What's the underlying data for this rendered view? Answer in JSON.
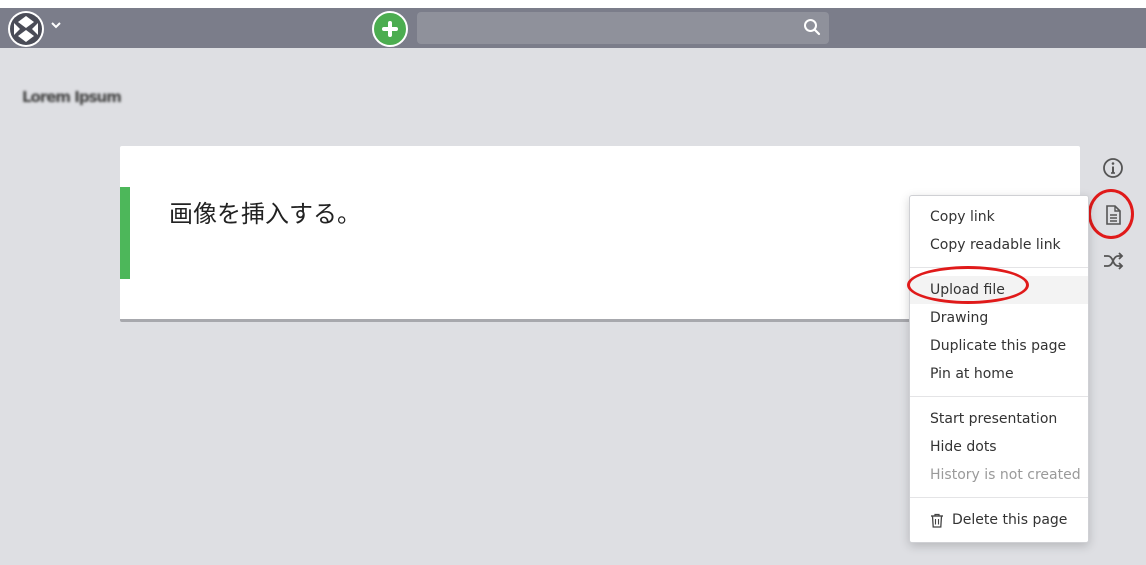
{
  "navbar": {
    "logo_icon": "project-logo-icon",
    "caret_icon": "chevron-down-icon",
    "add_icon": "plus-icon",
    "search": {
      "value": "",
      "placeholder": ""
    },
    "search_icon": "search-icon",
    "bg_color": "#7b7d8a"
  },
  "page": {
    "project_title": "Lorem Ipsum",
    "card": {
      "text": "画像を挿入する。",
      "accent_color": "#4db75a"
    }
  },
  "sidebar_icons": [
    "info-icon",
    "document-icon",
    "shuffle-icon"
  ],
  "page_menu": {
    "groups": [
      [
        {
          "label": "Copy link"
        },
        {
          "label": "Copy readable link"
        }
      ],
      [
        {
          "label": "Upload file"
        },
        {
          "label": "Drawing"
        },
        {
          "label": "Duplicate this page"
        },
        {
          "label": "Pin at home"
        }
      ],
      [
        {
          "label": "Start presentation"
        },
        {
          "label": "Hide dots"
        },
        {
          "label": "History is not created",
          "disabled": true
        }
      ],
      [
        {
          "label": "Delete this page",
          "icon": "trash-icon"
        }
      ]
    ]
  },
  "annotations": {
    "color": "#e01a1a"
  }
}
